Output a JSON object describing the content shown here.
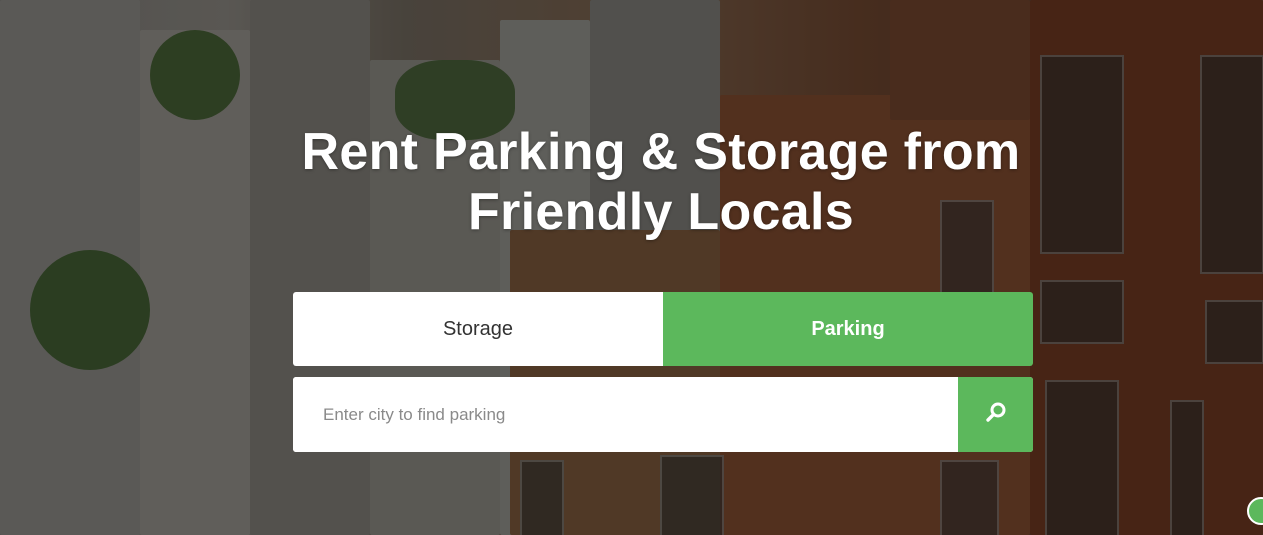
{
  "hero": {
    "headline": "Rent Parking & Storage from Friendly Locals"
  },
  "tabs": [
    {
      "label": "Storage",
      "active": false
    },
    {
      "label": "Parking",
      "active": true
    }
  ],
  "search": {
    "placeholder": "Enter city to find parking",
    "value": "",
    "button_icon": "search-icon"
  },
  "colors": {
    "accent": "#5cb85c",
    "tab_inactive_bg": "#ffffff",
    "headline": "#ffffff"
  }
}
